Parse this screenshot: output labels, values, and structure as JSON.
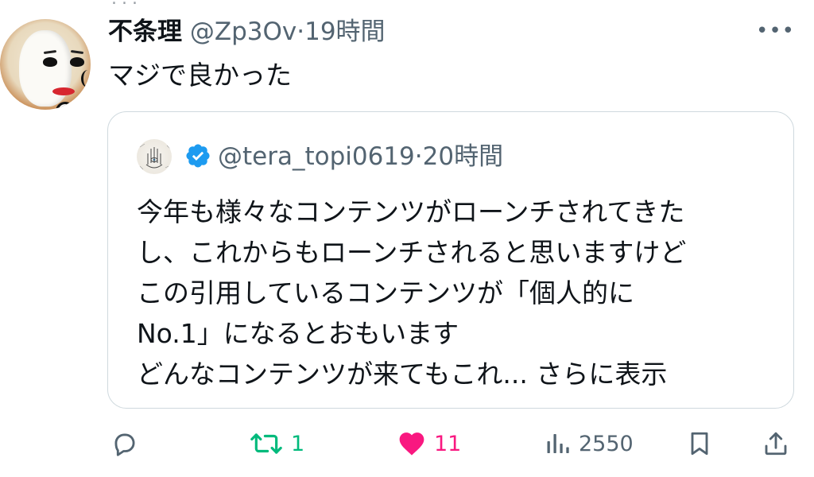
{
  "top_fragment": "...",
  "tweet": {
    "author_name": "不条理",
    "author_handle": "@Zp3Ov",
    "separator": "·",
    "time": "19時間",
    "more_label": "•••",
    "text": "マジで良かった",
    "avatar_icon": "mask-avatar-icon"
  },
  "quote": {
    "avatar_icon": "palm-eye-avatar-icon",
    "verified_icon": "verified-badge-icon",
    "verified_color": "#1d9bf0",
    "handle": "@tera_topi0619",
    "separator": "·",
    "time": "20時間",
    "lines": [
      "今年も様々なコンテンツがローンチされてきた",
      "し、これからもローンチされると思いますけど",
      "この引用しているコンテンツが「個人的に",
      "No.1」になるとおもいます",
      "どんなコンテンツが来てもこれ..."
    ],
    "show_more": "さらに表示"
  },
  "actions": {
    "reply": {
      "icon": "reply-icon",
      "count": ""
    },
    "retweet": {
      "icon": "retweet-icon",
      "count": "1",
      "color": "#00ba7c"
    },
    "like": {
      "icon": "heart-icon",
      "count": "11",
      "color": "#f91880"
    },
    "views": {
      "icon": "views-icon",
      "count": "2550"
    },
    "bookmark": {
      "icon": "bookmark-icon"
    },
    "share": {
      "icon": "share-icon"
    }
  }
}
